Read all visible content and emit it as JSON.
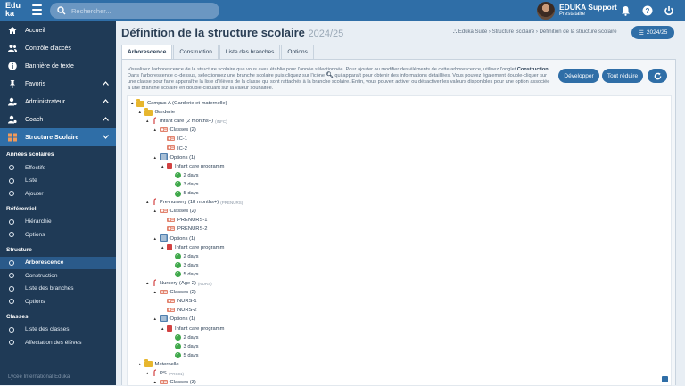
{
  "app": {
    "logo_top": "Edu",
    "logo_bottom": "ka"
  },
  "search": {
    "placeholder": "Rechercher..."
  },
  "user": {
    "name": "EDUKA Support",
    "role": "Prestataire"
  },
  "sidebar": {
    "items": [
      {
        "label": "Accueil",
        "icon": "home-icon"
      },
      {
        "label": "Contrôle d'accès",
        "icon": "users-icon"
      },
      {
        "label": "Bannière de texte",
        "icon": "info-icon"
      },
      {
        "label": "Favoris",
        "icon": "pin-icon"
      },
      {
        "label": "Administrateur",
        "icon": "user-gear-icon"
      },
      {
        "label": "Coach",
        "icon": "user-gear-icon"
      },
      {
        "label": "Structure Scolaire",
        "icon": "structure-icon"
      }
    ],
    "groups": [
      {
        "title": "Années scolaires",
        "links": [
          "Effectifs",
          "Liste",
          "Ajouter"
        ]
      },
      {
        "title": "Référentiel",
        "links": [
          "Hiérarchie",
          "Options"
        ]
      },
      {
        "title": "Structure",
        "links": [
          "Arborescence",
          "Construction",
          "Liste des branches",
          "Options"
        ]
      },
      {
        "title": "Classes",
        "links": [
          "Liste des classes",
          "Affectation des élèves"
        ]
      }
    ],
    "footer": "Lycée International Eduka"
  },
  "header": {
    "title": "Définition de la structure scolaire",
    "year": "2024/25",
    "breadcrumb": "Eduka Suite › Structure Scolaire › Définition de la structure scolaire",
    "year_button": "2024/25"
  },
  "tabs": [
    "Arborescence",
    "Construction",
    "Liste des branches",
    "Options"
  ],
  "intro": {
    "p1": "Visualisez l'arborescence de la structure scolaire que vous avez établie pour l'année sélectionnée. Pour ajouter ou modifier des éléments de cette arborescence, utilisez l'onglet ",
    "p1_bold": "Construction",
    "p2": ". Dans l'arborescence ci-dessus, sélectionnez une branche scolaire puis cliquez sur l'icône ",
    "p3": " qui apparaît pour obtenir des informations détaillées. Vous pouvez également double-cliquer sur une classe pour faire apparaître la liste d'élèves de la classe qui sont rattachés à la branche scolaire. Enfin, vous pouvez activer ou désactiver les valeurs disponibles pour une option associée à une branche scolaire en double-cliquant sur la valeur souhaitée."
  },
  "buttons": {
    "expand": "Développer",
    "collapse": "Tout réduire"
  },
  "tree": [
    {
      "d": 0,
      "t": "folder",
      "label": "Campus A (Garderie et maternelle)"
    },
    {
      "d": 1,
      "t": "folder",
      "label": "Garderie"
    },
    {
      "d": 2,
      "t": "branch",
      "label": "Infant care (2 months+)",
      "code": "(INFC)"
    },
    {
      "d": 3,
      "t": "classes",
      "label": "Classes (2)"
    },
    {
      "d": 4,
      "t": "class",
      "label": "IC-1"
    },
    {
      "d": 4,
      "t": "class",
      "label": "IC-2"
    },
    {
      "d": 3,
      "t": "options",
      "label": "Options (1)"
    },
    {
      "d": 4,
      "t": "book",
      "label": "Infant care programm"
    },
    {
      "d": 5,
      "t": "check",
      "label": "2 days"
    },
    {
      "d": 5,
      "t": "check",
      "label": "3 days"
    },
    {
      "d": 5,
      "t": "check",
      "label": "5 days"
    },
    {
      "d": 2,
      "t": "branch",
      "label": "Pre-nursery (18 months+)",
      "code": "(PRENURS)"
    },
    {
      "d": 3,
      "t": "classes",
      "label": "Classes (2)"
    },
    {
      "d": 4,
      "t": "class",
      "label": "PRENURS-1"
    },
    {
      "d": 4,
      "t": "class",
      "label": "PRENURS-2"
    },
    {
      "d": 3,
      "t": "options",
      "label": "Options (1)"
    },
    {
      "d": 4,
      "t": "book",
      "label": "Infant care programm"
    },
    {
      "d": 5,
      "t": "check",
      "label": "2 days"
    },
    {
      "d": 5,
      "t": "check",
      "label": "3 days"
    },
    {
      "d": 5,
      "t": "check",
      "label": "5 days"
    },
    {
      "d": 2,
      "t": "branch",
      "label": "Nursery (Age 2)",
      "code": "(NURS)"
    },
    {
      "d": 3,
      "t": "classes",
      "label": "Classes (2)"
    },
    {
      "d": 4,
      "t": "class",
      "label": "NURS-1"
    },
    {
      "d": 4,
      "t": "class",
      "label": "NURS-2"
    },
    {
      "d": 3,
      "t": "options",
      "label": "Options (1)"
    },
    {
      "d": 4,
      "t": "book",
      "label": "Infant care programm"
    },
    {
      "d": 5,
      "t": "check",
      "label": "2 days"
    },
    {
      "d": 5,
      "t": "check",
      "label": "3 days"
    },
    {
      "d": 5,
      "t": "check",
      "label": "5 days"
    },
    {
      "d": 1,
      "t": "folder",
      "label": "Maternelle"
    },
    {
      "d": 2,
      "t": "branch",
      "label": "PS",
      "code": "(PRS01)"
    },
    {
      "d": 3,
      "t": "classes",
      "label": "Classes (3)"
    }
  ]
}
